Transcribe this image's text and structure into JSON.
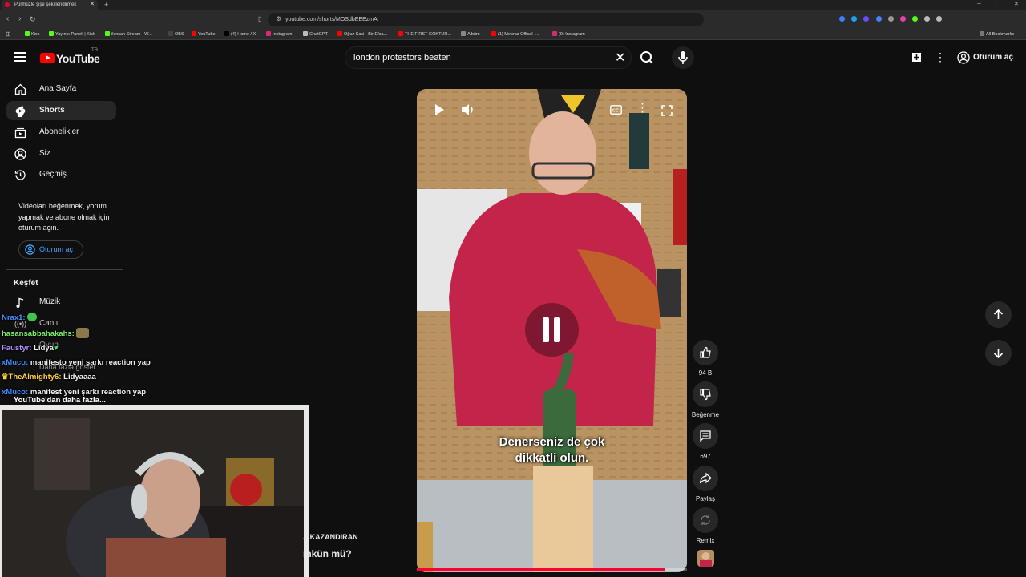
{
  "browser": {
    "tab_title": "Pürmüzle şişe şekillendirmek",
    "url": "youtube.com/shorts/MOSdbEEEzmA",
    "bookmarks": [
      {
        "label": "Kick",
        "color": "#53fc18"
      },
      {
        "label": "Yayıncı Paneli | Kick",
        "color": "#53fc18"
      },
      {
        "label": "ikinsan Stream - W...",
        "color": "#53fc18"
      },
      {
        "label": "OBS",
        "color": "#444"
      },
      {
        "label": "YouTube",
        "color": "#ff0000"
      },
      {
        "label": "(4) Home / X",
        "color": "#000"
      },
      {
        "label": "Instagram",
        "color": "#d62976"
      },
      {
        "label": "ChatGPT",
        "color": "#bbb"
      },
      {
        "label": "Oğuz Sasi - Bir Efsa...",
        "color": "#ff0000"
      },
      {
        "label": "THE FIRST GOKTUR...",
        "color": "#ff0000"
      },
      {
        "label": "Albüm",
        "color": "#888"
      },
      {
        "label": "(1) Mepraz Offical -...",
        "color": "#ff0000"
      },
      {
        "label": "(9) Instagram",
        "color": "#d62976"
      }
    ],
    "all_bookmarks": "All Bookmarks"
  },
  "masthead": {
    "logo": "YouTube",
    "country": "TR",
    "search_value": "london protestors beaten",
    "signin": "Oturum aç"
  },
  "sidebar": {
    "items": [
      {
        "label": "Ana Sayfa"
      },
      {
        "label": "Shorts"
      },
      {
        "label": "Abonelikler"
      },
      {
        "label": "Siz"
      },
      {
        "label": "Geçmiş"
      }
    ],
    "signin_note": "Videoları beğenmek, yorum yapmak ve abone olmak için oturum açın.",
    "signin_button": "Oturum aç",
    "explore_title": "Keşfet",
    "explore_items": [
      {
        "label": "Müzik"
      },
      {
        "label": "Canlı"
      },
      {
        "label": "Oyun"
      },
      {
        "label": "Daha fazla göster"
      }
    ],
    "more_from": "YouTube'dan daha fazla..."
  },
  "chat": [
    {
      "user": "Nrax1:",
      "text": "",
      "color": "#4a90ff"
    },
    {
      "user": "hasansabbahakahs:",
      "text": "",
      "color": "#7cf06a"
    },
    {
      "user": "Faustyr:",
      "text": "Lidya",
      "color": "#b889ff"
    },
    {
      "user": "xMuco:",
      "text": "manifesto yeni şarkı reaction yap",
      "color": "#3d8bff"
    },
    {
      "user": "TheAlmighty6:",
      "text": "Lidyaaaa",
      "color": "#ffd23a"
    },
    {
      "user": "xMuco:",
      "text": "manifest yeni şarkı reaction yap",
      "color": "#3d8bff"
    }
  ],
  "short": {
    "caption_line1": "Denerseniz de çok",
    "caption_line2": "dikkatli olun.",
    "progress": 0.92,
    "likes": "94 B",
    "dislike_label": "Beğenme",
    "comments": "697",
    "share_label": "Paylaş",
    "remix_label": "Remix"
  },
  "partial_text": {
    "line1": "A KAZANDIRAN",
    "line2": "mkün mü?"
  }
}
